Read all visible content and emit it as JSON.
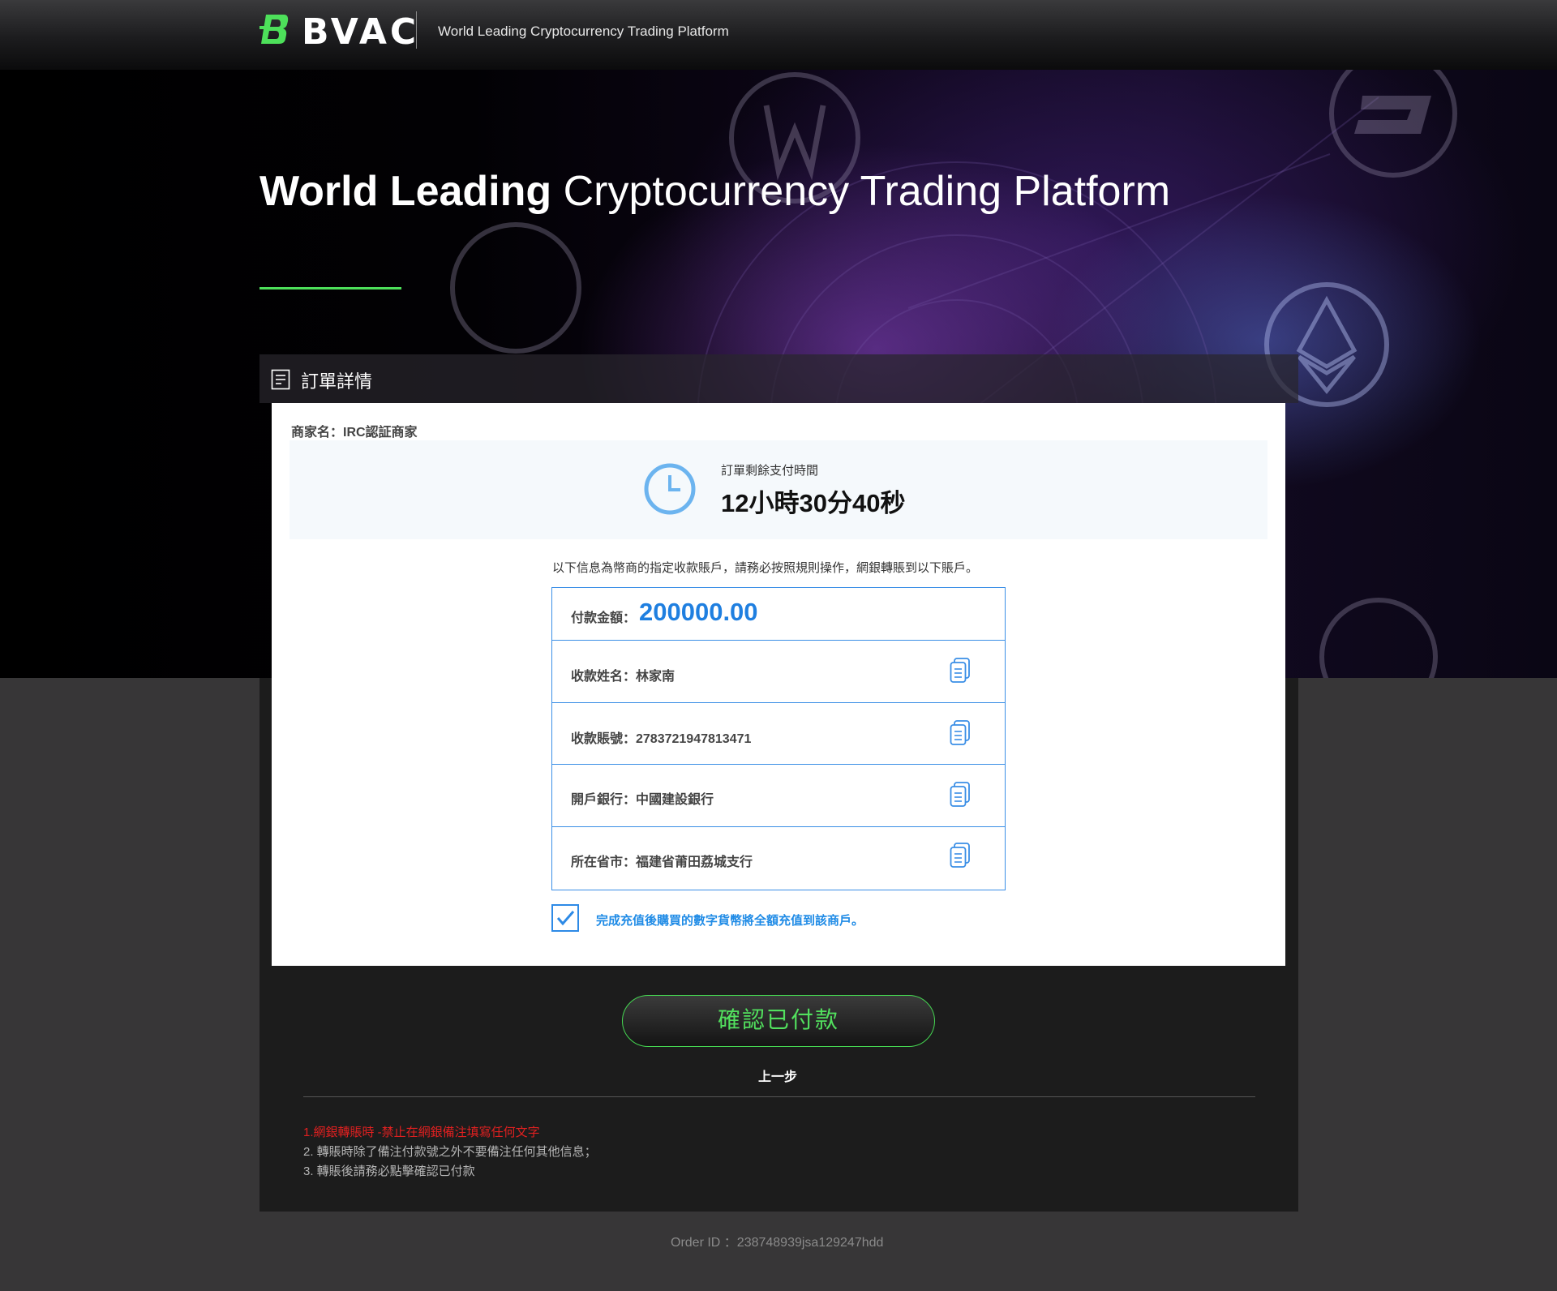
{
  "header": {
    "logo_text": "BVAC",
    "tagline": "World Leading Cryptocurrency Trading Platform"
  },
  "hero": {
    "title_bold": "World Leading",
    "title_light": "Cryptocurrency Trading Platform"
  },
  "order": {
    "panel_title": "訂單詳情",
    "merchant": "商家名：IRC認証商家",
    "timer_label": "訂單剩餘支付時間",
    "timer_value": "12小時30分40秒",
    "notice": "以下信息為幣商的指定收款賬戶，請務必按照規則操作，網銀轉賬到以下賬戶。",
    "amount_label": "付款金額：",
    "amount_value": "200000.00",
    "rows": [
      {
        "label": "收款姓名：林家南"
      },
      {
        "label": "收款賬號：2783721947813471"
      },
      {
        "label": "開戶銀行：中國建設銀行"
      },
      {
        "label": "所在省市：福建省莆田荔城支行"
      }
    ],
    "checkbox_text": "完成充值後購買的數字貨幣將全額充值到該商戶。",
    "checkbox_checked": true
  },
  "actions": {
    "confirm_label": "確認已付款",
    "back_label": "上一步"
  },
  "tips": [
    "1.網銀轉賬時 -禁止在網銀備注填寫任何文字",
    "2. 轉賬時除了備注付款號之外不要備注任何其他信息；",
    "3. 轉賬後請務必點擊確認已付款"
  ],
  "footer": {
    "order_id": "Order ID ：238748939jsa129247hdd"
  },
  "colors": {
    "accent_green": "#4de05a",
    "accent_blue": "#1f7fe0",
    "warning_red": "#e02020"
  }
}
